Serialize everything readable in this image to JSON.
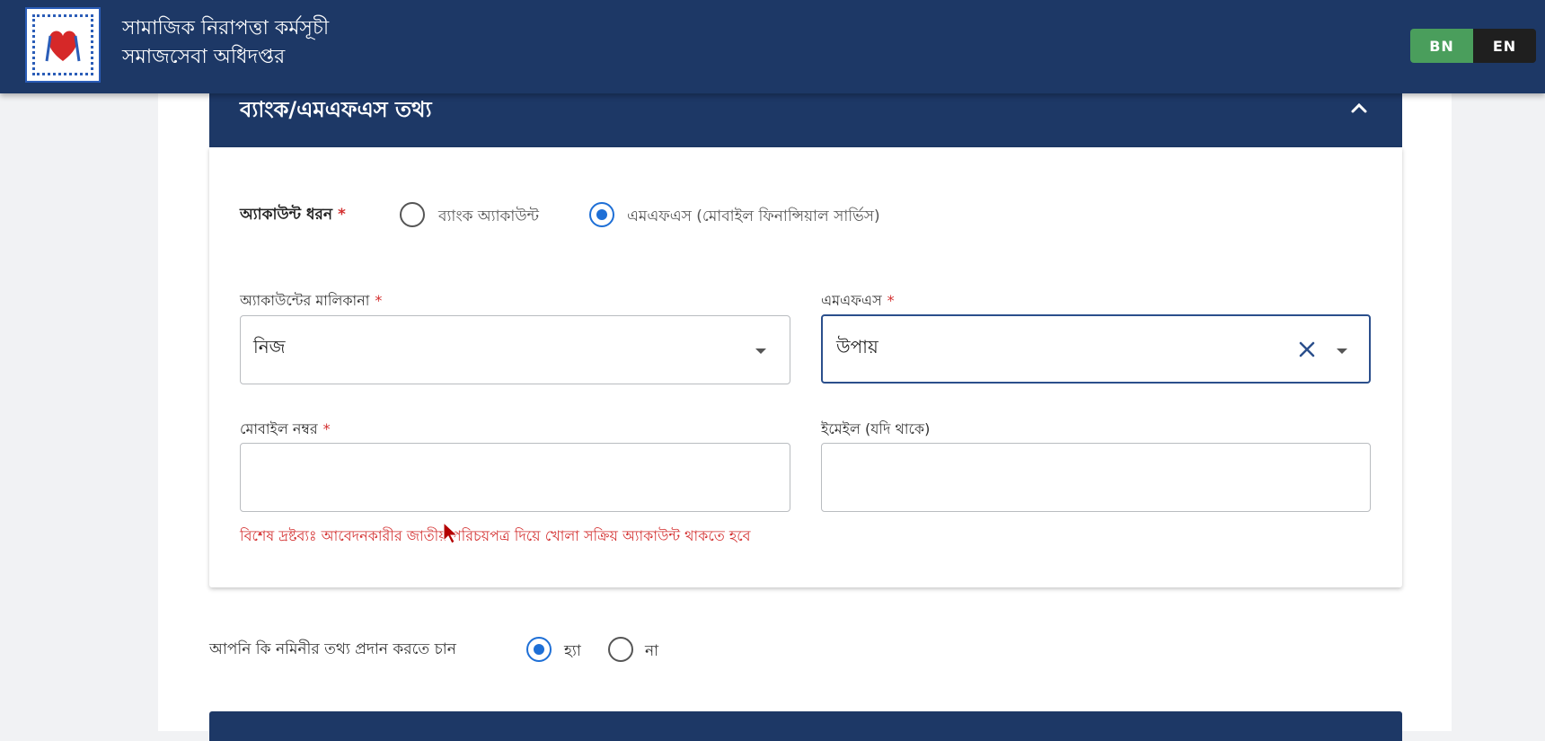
{
  "header": {
    "title_line1": "সামাজিক নিরাপত্তা কর্মসূচী",
    "title_line2": "সমাজসেবা অধিদপ্তর",
    "lang_bn": "BN",
    "lang_en": "EN",
    "active_lang": "BN"
  },
  "section": {
    "title": "ব্যাংক/এমএফএস তথ্য",
    "account_type": {
      "label": "অ্যাকাউন্ট ধরন",
      "required_mark": "*",
      "options": [
        "ব্যাংক অ্যাকাউন্ট",
        "এমএফএস (মোবাইল ফিনান্সিয়াল সার্ভিস)"
      ],
      "selected": "এমএফএস (মোবাইল ফিনান্সিয়াল সার্ভিস)"
    },
    "ownership": {
      "label": "অ্যাকাউন্টের মালিকানা",
      "required_mark": "*",
      "value": "নিজ"
    },
    "mfs": {
      "label": "এমএফএস",
      "required_mark": "*",
      "value": "উপায়"
    },
    "mobile": {
      "label": "মোবাইল নম্বর",
      "required_mark": "*",
      "value": ""
    },
    "email": {
      "label": "ইমেইল (যদি থাকে)",
      "value": ""
    },
    "note": "বিশেষ দ্রষ্টব্যঃ আবেদনকারীর জাতীয় পরিচয়পত্র দিয়ে খোলা সক্রিয় অ্যাকাউন্ট থাকতে হবে"
  },
  "nominee": {
    "question": "আপনি কি নমিনীর তথ্য প্রদান করতে চান",
    "options": [
      "হ্যা",
      "না"
    ],
    "selected": "হ্যা"
  },
  "colors": {
    "header_bg": "#1d3866",
    "accent_blue": "#1e6fd6",
    "error_red": "#d32f2f",
    "lang_active": "#4a9e5c"
  }
}
